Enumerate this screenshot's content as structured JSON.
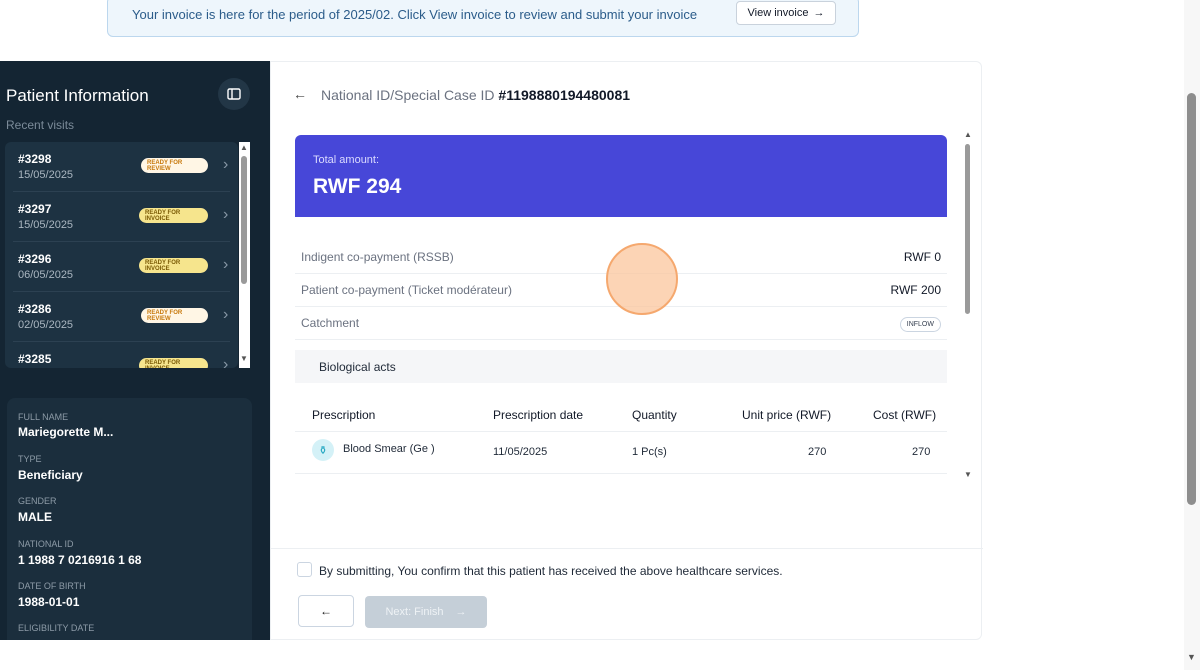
{
  "banner": {
    "text": "Your invoice is here for the period of 2025/02. Click View invoice to review and submit your invoice",
    "button_label": "View invoice"
  },
  "sidebar": {
    "title": "Patient Information",
    "subtitle": "Recent visits",
    "visits": [
      {
        "id": "#3298",
        "date": "15/05/2025",
        "status": "READY FOR REVIEW"
      },
      {
        "id": "#3297",
        "date": "15/05/2025",
        "status": "READY FOR INVOICE"
      },
      {
        "id": "#3296",
        "date": "06/05/2025",
        "status": "READY FOR INVOICE"
      },
      {
        "id": "#3286",
        "date": "02/05/2025",
        "status": "READY FOR REVIEW"
      },
      {
        "id": "#3285",
        "date": "",
        "status": "READY FOR INVOICE"
      }
    ],
    "info": [
      {
        "label": "FULL NAME",
        "value": "Mariegorette M..."
      },
      {
        "label": "TYPE",
        "value": "Beneficiary"
      },
      {
        "label": "GENDER",
        "value": "MALE"
      },
      {
        "label": "NATIONAL ID",
        "value": "1 1988 7 0216916 1 68"
      },
      {
        "label": "DATE OF BIRTH",
        "value": "1988-01-01"
      },
      {
        "label": "ELIGIBILITY DATE",
        "value": ""
      }
    ]
  },
  "main": {
    "id_label": "National ID/Special Case ID",
    "id_value": "#1198880194480081",
    "total_label": "Total amount:",
    "total_value": "RWF 294",
    "rows": [
      {
        "label": "Indigent co-payment (RSSB)",
        "value": "RWF 0"
      },
      {
        "label": "Patient co-payment (Ticket modérateur)",
        "value": "RWF 200"
      },
      {
        "label": "Catchment",
        "value": "INFLOW"
      }
    ],
    "section_title": "Biological acts",
    "table": {
      "headers": [
        "Prescription",
        "Prescription date",
        "Quantity",
        "Unit price (RWF)",
        "Cost (RWF)"
      ],
      "rows": [
        {
          "prescription": "Blood Smear (Ge )",
          "date": "11/05/2025",
          "quantity": "1 Pc(s)",
          "unit_price": "270",
          "cost": "270"
        }
      ]
    },
    "confirm_text": "By submitting, You confirm that this patient has received the above healthcare services.",
    "back_arrow": "←",
    "next_label": "Next: Finish"
  }
}
